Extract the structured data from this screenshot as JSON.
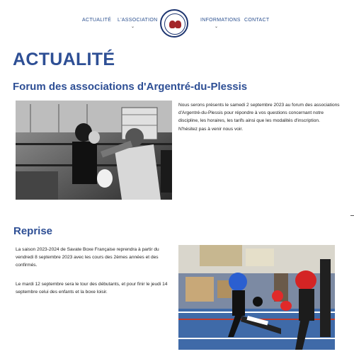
{
  "nav": {
    "items": [
      {
        "label": "ACTUALITÉ",
        "has_dropdown": false
      },
      {
        "label": "L'ASSOCIATION",
        "has_dropdown": true
      },
      {
        "label": "INFORMATIONS",
        "has_dropdown": true
      },
      {
        "label": "CONTACT",
        "has_dropdown": false
      }
    ],
    "chevron": "⌄"
  },
  "logo": {
    "alt": "BOXE club logo"
  },
  "page": {
    "title": "ACTUALITÉ"
  },
  "articles": [
    {
      "title": "Forum des associations d'Argentré-du-Plessis",
      "paragraphs": [
        "Nous serons présents le samedi 2 septembre 2023 au forum des associations d'Argentré-du-Plessis pour répondre à vos questions concernant notre discipline, les horaires, les tarifs ainsi que les modalités d'inscription. N'hésitez pas à venir nous voir."
      ],
      "image": "boxing-training-photo"
    },
    {
      "title": "Reprise",
      "paragraphs": [
        "La saison 2023-2024 de Savate Boxe Française reprendra à partir du vendredi 8 septembre 2023 avec les cours des 2èmes années et des confirmés.",
        "Le mardi 12 septembre sera le tour des débutants, et pour finir le jeudi 14 septembre celui des enfants et la boxe loisir."
      ],
      "image": "kids-boxing-photo"
    }
  ],
  "colors": {
    "heading": "#2e4f95",
    "nav": "#2a4f8f",
    "logo_ring": "#1d3570",
    "glove": "#a3262a"
  }
}
